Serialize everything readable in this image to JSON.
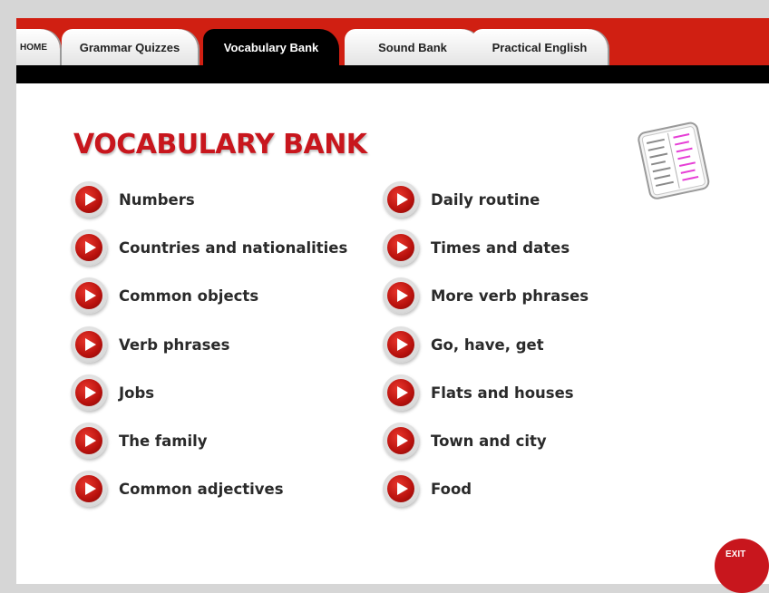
{
  "tabs": [
    {
      "label": "HOME"
    },
    {
      "label": "Grammar Quizzes"
    },
    {
      "label": "Vocabulary Bank"
    },
    {
      "label": "Sound Bank"
    },
    {
      "label": "Practical English"
    }
  ],
  "active_tab": "Vocabulary Bank",
  "page_title": "VOCABULARY BANK",
  "left_items": [
    {
      "label": "Numbers"
    },
    {
      "label": "Countries and nationalities"
    },
    {
      "label": "Common objects"
    },
    {
      "label": "Verb phrases"
    },
    {
      "label": "Jobs"
    },
    {
      "label": "The family"
    },
    {
      "label": "Common adjectives"
    }
  ],
  "right_items": [
    {
      "label": "Daily routine"
    },
    {
      "label": "Times and dates"
    },
    {
      "label": "More verb phrases"
    },
    {
      "label": "Go, have, get"
    },
    {
      "label": "Flats and houses"
    },
    {
      "label": "Town and city"
    },
    {
      "label": "Food"
    }
  ],
  "exit_label": "EXIT",
  "colors": {
    "brand_red": "#c8161d",
    "nav_red": "#d01f12",
    "nav_black": "#000000"
  },
  "icons": {
    "play": "play-icon",
    "document": "vocabulary-list-icon"
  }
}
